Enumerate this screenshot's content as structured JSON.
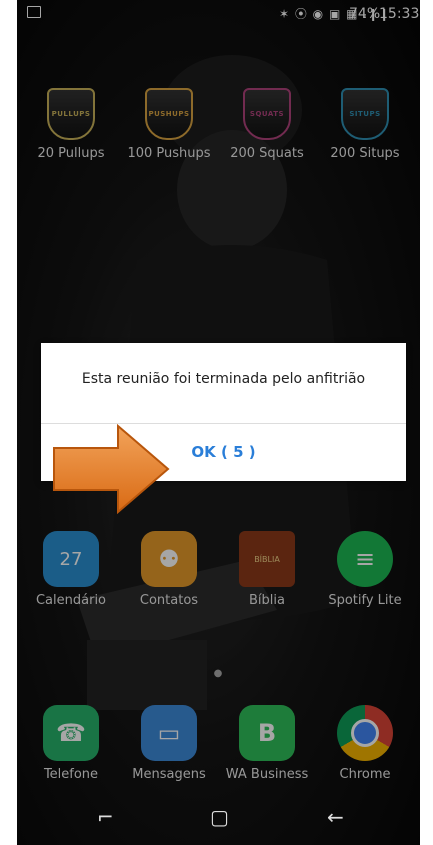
{
  "statusbar": {
    "icons": "✶ ⦿ ◉ ▣ ▦ .❙❙",
    "battery": "74%",
    "time": "15:33"
  },
  "apps_top": [
    {
      "label": "20 Pullups",
      "badge": "PULLUPS",
      "color": "#c9b35a"
    },
    {
      "label": "100 Pushups",
      "badge": "PUSHUPS",
      "color": "#d9a441"
    },
    {
      "label": "200 Squats",
      "badge": "SQUATS",
      "color": "#b0427c"
    },
    {
      "label": "200 Situps",
      "badge": "SITUPS",
      "color": "#2f8fb2"
    }
  ],
  "apps_middle": [
    {
      "label": "Calendário",
      "icon": "calendar-icon",
      "color": "#2a8fd1",
      "glyph": "27"
    },
    {
      "label": "Contatos",
      "icon": "contacts-icon",
      "color": "#e59a2a",
      "glyph": "⚉"
    },
    {
      "label": "Bíblia",
      "icon": "bible-icon",
      "color": "#8c3a1a",
      "glyph": "BÍBLIA"
    },
    {
      "label": "Spotify Lite",
      "icon": "spotify-icon",
      "color": "#1db954",
      "glyph": "≡"
    }
  ],
  "apps_dock": [
    {
      "label": "Telefone",
      "icon": "phone-icon",
      "color": "#27b36a",
      "glyph": "☎"
    },
    {
      "label": "Mensagens",
      "icon": "messages-icon",
      "color": "#3d8ad9",
      "glyph": "▭"
    },
    {
      "label": "WA Business",
      "icon": "whatsapp-business-icon",
      "color": "#2fbf5a",
      "glyph": "B"
    },
    {
      "label": "Chrome",
      "icon": "chrome-icon",
      "color": "#e0e0e0",
      "glyph": "◉"
    }
  ],
  "dialog": {
    "message": "Esta reunião foi terminada pelo anfitrião",
    "ok_label": "OK ( 5 )"
  },
  "navbar": {
    "recent": "⌐",
    "home": "▢",
    "back": "←"
  },
  "colors": {
    "accent": "#2a7ed8",
    "arrow": "#e88a2e"
  }
}
